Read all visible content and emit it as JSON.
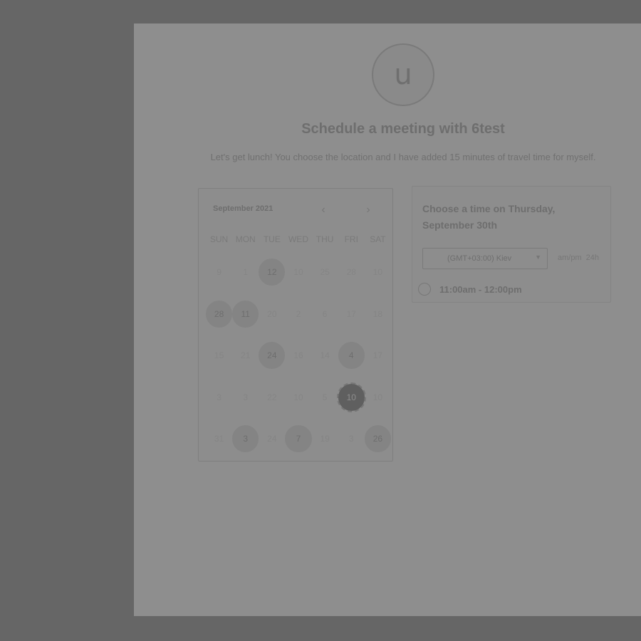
{
  "header": {
    "avatar_letter": "u",
    "title": "Schedule a meeting with 6test",
    "description": "Let's get lunch! You choose the location and I have added 15 minutes of travel time for myself."
  },
  "calendar": {
    "month_label": "September 2021",
    "prev_icon": "chevron-left-icon",
    "next_icon": "chevron-right-icon",
    "weekdays": [
      "SUN",
      "MON",
      "TUE",
      "WED",
      "THU",
      "FRI",
      "SAT"
    ],
    "weeks": [
      [
        "9",
        "1",
        "12",
        "10",
        "25",
        "28",
        "10"
      ],
      [
        "28",
        "11",
        "20",
        "2",
        "6",
        "17",
        "18"
      ],
      [
        "15",
        "21",
        "24",
        "16",
        "14",
        "4",
        "17"
      ],
      [
        "3",
        "3",
        "22",
        "10",
        "5",
        "10",
        "10"
      ],
      [
        "31",
        "3",
        "24",
        "7",
        "19",
        "3",
        "26"
      ]
    ],
    "available_days": [
      [
        0,
        2
      ],
      [
        1,
        0
      ],
      [
        1,
        1
      ],
      [
        2,
        2
      ],
      [
        2,
        5
      ],
      [
        4,
        1
      ],
      [
        4,
        3
      ],
      [
        4,
        6
      ]
    ],
    "selected_day": [
      3,
      5
    ]
  },
  "times": {
    "heading": "Choose a time on Thursday, September 30th",
    "timezone": "(GMT+03:00) Kiev",
    "format_12h": "am/pm",
    "format_24h": "24h",
    "slot": "11:00am - 12:00pm"
  }
}
